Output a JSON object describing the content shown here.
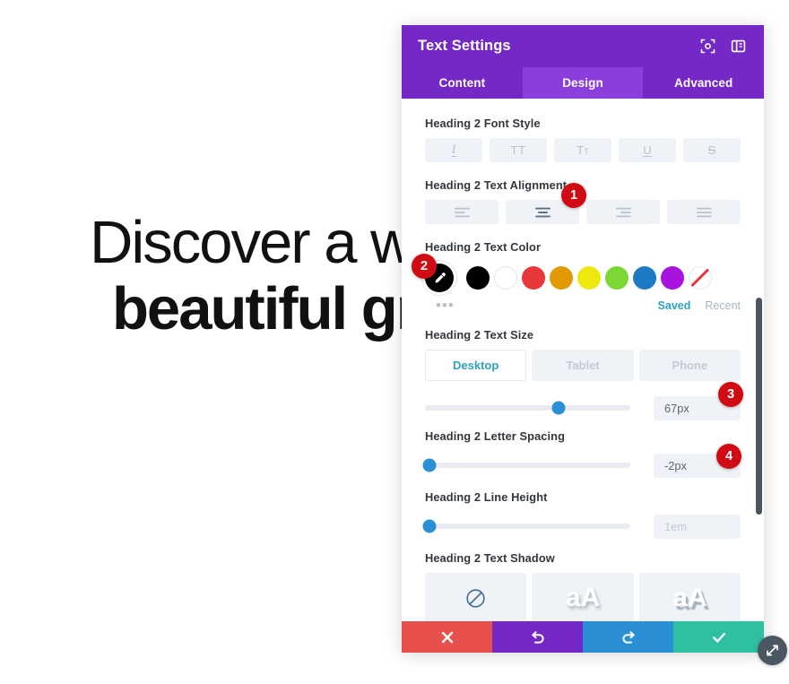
{
  "background": {
    "heading_line1": "Discover a wo",
    "heading_line2": "beautiful gr"
  },
  "panel": {
    "title": "Text Settings",
    "header_icons": [
      {
        "name": "focus-target-icon",
        "label": "Focus"
      },
      {
        "name": "panel-layout-icon",
        "label": "Layout"
      }
    ],
    "tabs": [
      {
        "label": "Content",
        "active": false
      },
      {
        "label": "Design",
        "active": true
      },
      {
        "label": "Advanced",
        "active": false
      }
    ],
    "font_style": {
      "label": "Heading 2 Font Style",
      "options": [
        {
          "name": "italic-icon",
          "glyph": "I"
        },
        {
          "name": "uppercase-icon",
          "glyph": "TT"
        },
        {
          "name": "small-caps-icon",
          "glyph": "Tт"
        },
        {
          "name": "underline-icon",
          "glyph": "U"
        },
        {
          "name": "strikethrough-icon",
          "glyph": "S"
        }
      ]
    },
    "text_alignment": {
      "label": "Heading 2 Text Alignment",
      "options": [
        {
          "name": "align-left-icon",
          "active": false
        },
        {
          "name": "align-center-icon",
          "active": true
        },
        {
          "name": "align-right-icon",
          "active": false
        },
        {
          "name": "align-justify-icon",
          "active": false
        }
      ]
    },
    "text_color": {
      "label": "Heading 2 Text Color",
      "selected": "#000000",
      "swatches": [
        {
          "name": "swatch-black",
          "color": "#000000"
        },
        {
          "name": "swatch-white",
          "color": "#ffffff"
        },
        {
          "name": "swatch-red",
          "color": "#e8383a"
        },
        {
          "name": "swatch-orange",
          "color": "#e09900"
        },
        {
          "name": "swatch-yellow",
          "color": "#ede90f"
        },
        {
          "name": "swatch-green",
          "color": "#7cd634"
        },
        {
          "name": "swatch-blue",
          "color": "#1f7ac4"
        },
        {
          "name": "swatch-purple",
          "color": "#a812de"
        },
        {
          "name": "swatch-none",
          "color": "transparent"
        }
      ],
      "more_label": "•••",
      "saved_label": "Saved",
      "recent_label": "Recent"
    },
    "text_size": {
      "label": "Heading 2 Text Size",
      "devices": [
        {
          "label": "Desktop",
          "active": true
        },
        {
          "label": "Tablet",
          "active": false
        },
        {
          "label": "Phone",
          "active": false
        }
      ],
      "value": "67px",
      "slider_percent": 65
    },
    "letter_spacing": {
      "label": "Heading 2 Letter Spacing",
      "value": "-2px",
      "slider_percent": 2
    },
    "line_height": {
      "label": "Heading 2 Line Height",
      "value": "1em",
      "slider_percent": 2
    },
    "text_shadow": {
      "label": "Heading 2 Text Shadow",
      "options": [
        {
          "name": "no-shadow-icon",
          "glyph": ""
        },
        {
          "name": "shadow-soft-icon",
          "glyph": "aA"
        },
        {
          "name": "shadow-hard-icon",
          "glyph": "aA"
        }
      ]
    },
    "footer": [
      {
        "name": "cancel-button",
        "icon": "close-icon"
      },
      {
        "name": "undo-button",
        "icon": "undo-icon"
      },
      {
        "name": "redo-button",
        "icon": "redo-icon"
      },
      {
        "name": "save-button",
        "icon": "check-icon"
      }
    ],
    "resize_handle": "resize-icon"
  },
  "annotations": [
    {
      "number": "1"
    },
    {
      "number": "2"
    },
    {
      "number": "3"
    },
    {
      "number": "4"
    }
  ],
  "colors": {
    "brand_purple": "#7428c5",
    "tab_active_purple": "#8a3fdd",
    "accent_blue": "#2a8fd4",
    "saved_teal": "#2ea3bd",
    "badge_red": "#d00b13"
  }
}
